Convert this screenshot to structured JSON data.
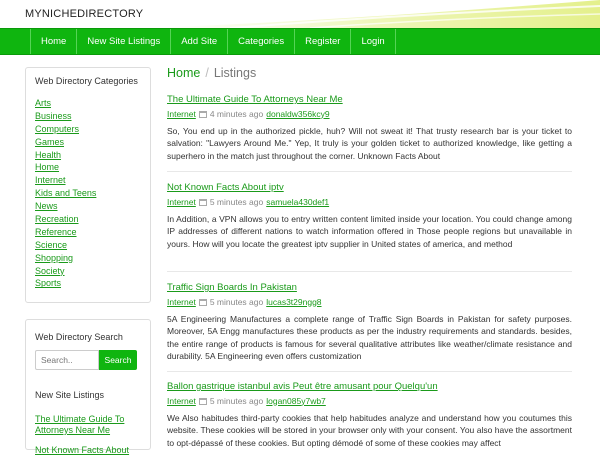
{
  "brand": "MYNICHEDIRECTORY",
  "nav": [
    "Home",
    "New Site Listings",
    "Add Site",
    "Categories",
    "Register",
    "Login"
  ],
  "sidebar": {
    "categories_title": "Web Directory Categories",
    "categories": [
      "Arts",
      "Business",
      "Computers",
      "Games",
      "Health",
      "Home",
      "Internet",
      "Kids and Teens",
      "News",
      "Recreation",
      "Reference",
      "Science",
      "Shopping",
      "Society",
      "Sports"
    ],
    "search_title": "Web Directory Search",
    "search_placeholder": "Search..",
    "search_button": "Search",
    "new_title": "New Site Listings",
    "new_listings": [
      "The Ultimate Guide To Attorneys Near Me",
      "Not Known Facts About"
    ]
  },
  "breadcrumb": {
    "home": "Home",
    "separator": "/",
    "current": "Listings"
  },
  "listings": [
    {
      "title": "The Ultimate Guide To Attorneys Near Me",
      "category": "Internet",
      "time": "4 minutes ago",
      "user": "donaldw356kcy9",
      "description": "So, You end up in the authorized pickle, huh? Will not sweat it! That trusty research bar is your ticket to salvation: \"Lawyers Around Me.\" Yep, It truly is your golden ticket to authorized knowledge, like getting a superhero in the match just throughout the corner. Unknown Facts About"
    },
    {
      "title": "Not Known Facts About iptv",
      "category": "Internet",
      "time": "5 minutes ago",
      "user": "samuela430def1",
      "description": "In Addition, a VPN allows you to entry written content limited inside your location. You could change among IP addresses of different nations to watch information offered in Those people regions but unavailable in yours. How will you locate the greatest iptv supplier in United states of america, and method"
    },
    {
      "title": "Traffic Sign Boards In Pakistan",
      "category": "Internet",
      "time": "5 minutes ago",
      "user": "lucas3t29ngg8",
      "description": "5A Engineering Manufactures a complete range of Traffic Sign Boards in Pakistan for safety purposes. Moreover, 5A Engg manufactures these products as per the industry requirements and standards. besides, the entire range of products is famous for several qualitative attributes like weather/climate resistance and durability. 5A Engineering even offers customization"
    },
    {
      "title": "Ballon gastrique istanbul avis Peut être amusant pour Quelqu'un",
      "category": "Internet",
      "time": "5 minutes ago",
      "user": "logan085y7wb7",
      "description": "We Also habitudes third-party cookies that help habitudes analyze and understand how you coutumes this website. These cookies will be stored in your browser only with your consent. You also have the assortment to opt-dépassé of these cookies. But opting démodé of some of these cookies may affect"
    }
  ],
  "colors": {
    "accent": "#0fb50f",
    "link": "#1a9a1a"
  }
}
